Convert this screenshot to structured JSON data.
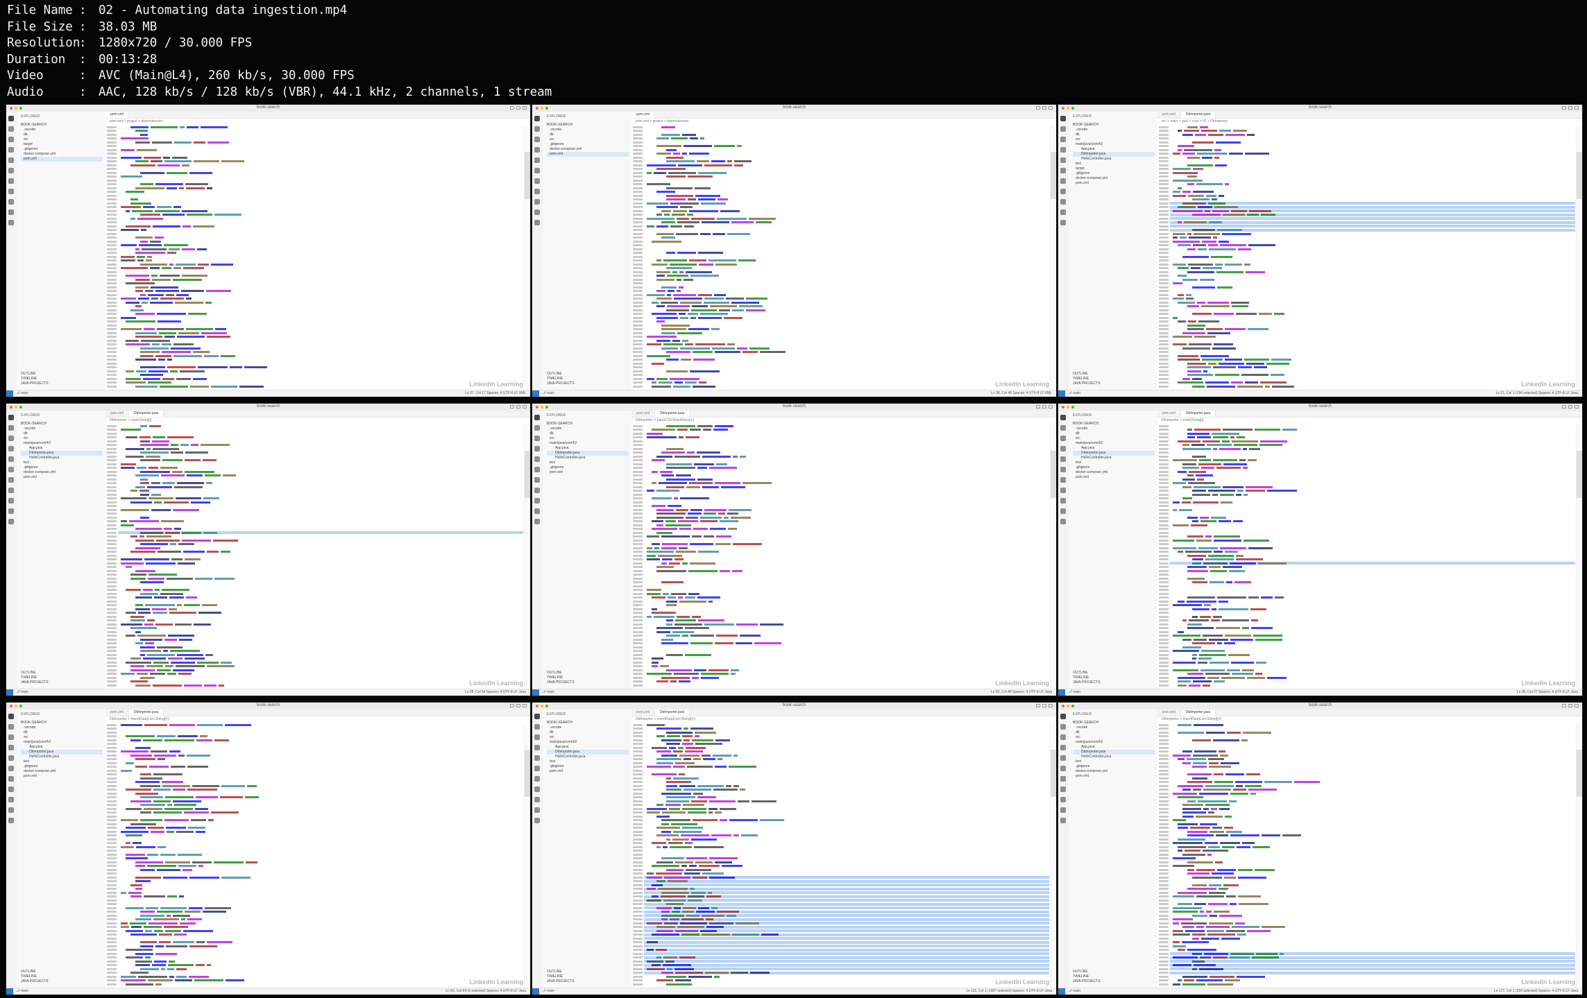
{
  "file_info": [
    {
      "key": "File Name",
      "value": "02 - Automating data ingestion.mp4"
    },
    {
      "key": "File Size",
      "value": "38.03 MB"
    },
    {
      "key": "Resolution",
      "value": "1280x720 / 30.000 FPS"
    },
    {
      "key": "Duration",
      "value": "00:13:28"
    },
    {
      "key": "Video",
      "value": "AVC (Main@L4), 260 kb/s, 30.000 FPS"
    },
    {
      "key": "Audio",
      "value": "AAC, 128 kb/s / 128 kb/s (VBR), 44.1 kHz, 2 channels, 1 stream"
    }
  ],
  "separator": ":",
  "window_title": "book-search",
  "sidebar_header": "EXPLORER",
  "sidebar_footer": [
    "OUTLINE",
    "TIMELINE",
    "JAVA PROJECTS"
  ],
  "watermark": "LinkedIn Learning",
  "colors": {
    "accent": "#2e7bcf",
    "selection": "#b6d3f7",
    "keyword": "#0000ff",
    "string": "#a31515",
    "comment": "#008000",
    "type": "#267f99"
  },
  "thumbnails": [
    {
      "tab1": "pom.xml",
      "tab2": "",
      "crumb": "pom.xml > project > dependencies",
      "tree": [
        "BOOK-SEARCH",
        ".vscode",
        "db",
        "src",
        "target",
        ".gitignore",
        "docker-compose.yml",
        "pom.xml"
      ],
      "status": "Ln 37, Col 17   Spaces: 4   UTF-8   LF   XML"
    },
    {
      "tab1": "pom.xml",
      "tab2": "",
      "crumb": "pom.xml > project > dependencies",
      "tree": [
        "BOOK-SEARCH",
        ".vscode",
        "db",
        "src",
        ".gitignore",
        "docker-compose.yml",
        "pom.xml"
      ],
      "status": "Ln 38, Col 48   Spaces: 4   UTF-8   LF   XML"
    },
    {
      "tab1": "pom.xml",
      "tab2": "DbImporter.java",
      "crumb": "src > main > java > com > h2 > DbImporter",
      "tree": [
        "BOOK-SEARCH",
        ".vscode",
        "db",
        "src",
        "main/java/com/h2",
        "App.java",
        "DbImporter.java",
        "HelloController.java",
        "test",
        "target",
        ".gitignore",
        "docker-compose.yml",
        "pom.xml"
      ],
      "status": "Ln 21, Col 1 (194 selected)   Spaces: 4   UTF-8   LF   Java"
    },
    {
      "tab1": "pom.xml",
      "tab2": "DbImporter.java",
      "crumb": "DbImporter > main(String[])",
      "tree": [
        "BOOK-SEARCH",
        ".vscode",
        "db",
        "src",
        "main/java/com/h2",
        "App.java",
        "DbImporter.java",
        "HelloController.java",
        "test",
        ".gitignore",
        "docker-compose.yml",
        "pom.xml"
      ],
      "status": "Ln 28, Col 54   Spaces: 4   UTF-8   LF   Java"
    },
    {
      "tab1": "pom.xml",
      "tab2": "DbImporter.java",
      "crumb": "DbImporter > parseCSV(InputStream)",
      "tree": [
        "BOOK-SEARCH",
        ".vscode",
        "db",
        "src",
        "main/java/com/h2",
        "App.java",
        "DbImporter.java",
        "HelloController.java",
        "test",
        ".gitignore",
        "pom.xml"
      ],
      "status": "Ln 63, Col 48   Spaces: 4   UTF-8   LF   Java"
    },
    {
      "tab1": "pom.xml",
      "tab2": "DbImporter.java",
      "crumb": "DbImporter > main(String[])",
      "tree": [
        "BOOK-SEARCH",
        ".vscode",
        "db",
        "src",
        "main/java/com/h2",
        "App.java",
        "DbImporter.java",
        "HelloController.java",
        "test",
        ".gitignore",
        "docker-compose.yml",
        "pom.xml"
      ],
      "status": "Ln 36, Col 27   Spaces: 4   UTF-8   LF   Java"
    },
    {
      "tab1": "pom.xml",
      "tab2": "DbImporter.java",
      "crumb": "DbImporter > insertData(List<String[]>)",
      "tree": [
        "BOOK-SEARCH",
        ".vscode",
        "db",
        "src",
        "main/java/com/h2",
        "App.java",
        "DbImporter.java",
        "HelloController.java",
        "test",
        ".gitignore",
        "docker-compose.yml",
        "pom.xml"
      ],
      "status": "Ln 83, Col 64 (9 selected)   Spaces: 4   UTF-8   LF   Java"
    },
    {
      "tab1": "pom.xml",
      "tab2": "DbImporter.java",
      "crumb": "DbImporter > insertData(List<String[]>)",
      "tree": [
        "BOOK-SEARCH",
        ".vscode",
        "db",
        "src",
        "main/java/com/h2",
        "App.java",
        "DbImporter.java",
        "HelloController.java",
        "test",
        ".gitignore",
        "pom.xml"
      ],
      "status": "Ln 115, Col 1 (1087 selected)   Spaces: 4   UTF-8   LF   Java"
    },
    {
      "tab1": "pom.xml",
      "tab2": "DbImporter.java",
      "crumb": "DbImporter > insertData(List<String[]>)",
      "tree": [
        "BOOK-SEARCH",
        ".vscode",
        "db",
        "src",
        "main/java/com/h2",
        "App.java",
        "DbImporter.java",
        "HelloController.java",
        "test",
        ".gitignore",
        "docker-compose.yml",
        "pom.xml"
      ],
      "status": "Ln 177, Col 1 (150 selected)   Spaces: 4   UTF-8   LF   Java"
    }
  ]
}
